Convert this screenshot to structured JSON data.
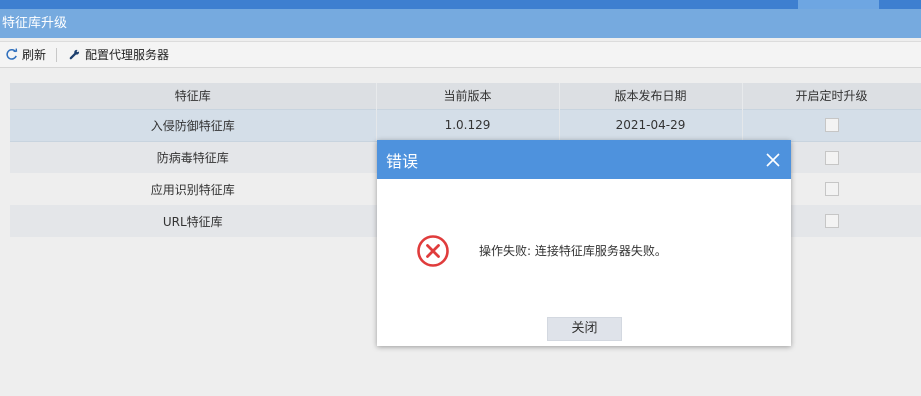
{
  "page": {
    "title": "特征库升级"
  },
  "toolbar": {
    "refresh_label": "刷新",
    "proxy_label": "配置代理服务器"
  },
  "table": {
    "columns": [
      "特征库",
      "当前版本",
      "版本发布日期",
      "开启定时升级"
    ],
    "rows": [
      {
        "name": "入侵防御特征库",
        "version": "1.0.129",
        "date": "2021-04-29",
        "scheduled": false
      },
      {
        "name": "防病毒特征库",
        "version": "",
        "date": "",
        "scheduled": false
      },
      {
        "name": "应用识别特征库",
        "version": "",
        "date": "",
        "scheduled": false
      },
      {
        "name": "URL特征库",
        "version": "",
        "date": "",
        "scheduled": false
      }
    ]
  },
  "dialog": {
    "title": "错误",
    "message": "操作失败: 连接特征库服务器失败。",
    "close_label": "关闭"
  },
  "icons": {
    "refresh": "refresh-icon",
    "proxy": "wrench-icon",
    "error": "error-circle-icon",
    "close": "close-icon"
  },
  "colors": {
    "header_blue": "#76aadf",
    "top_strip": "#3e7fd0",
    "dialog_header": "#4e92dd",
    "error_red": "#e03c3c"
  }
}
